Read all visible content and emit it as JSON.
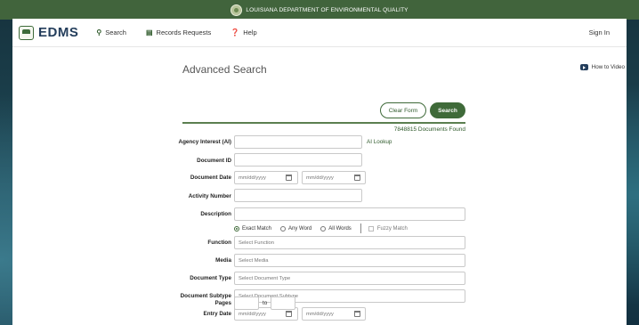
{
  "banner": {
    "text": "LOUISIANA DEPARTMENT OF ENVIRONMENTAL QUALITY"
  },
  "nav": {
    "logo": "EDMS",
    "items": [
      {
        "label": "Search",
        "icon": "search-icon"
      },
      {
        "label": "Records Requests",
        "icon": "document-icon"
      },
      {
        "label": "Help",
        "icon": "help-icon"
      }
    ],
    "signin": "Sign In"
  },
  "page": {
    "title": "Advanced Search",
    "howto": "How to Video",
    "clear_label": "Clear Form",
    "search_label": "Search",
    "found": "7848815 Documents Found"
  },
  "form": {
    "agency_interest": {
      "label": "Agency Interest (AI)",
      "value": "",
      "lookup": "AI Lookup"
    },
    "document_id": {
      "label": "Document ID",
      "value": ""
    },
    "document_date": {
      "label": "Document Date",
      "from_placeholder": "mm/dd/yyyy",
      "to_placeholder": "mm/dd/yyyy"
    },
    "activity_number": {
      "label": "Activity Number",
      "value": ""
    },
    "description": {
      "label": "Description",
      "value": "",
      "match_options": [
        "Exact Match",
        "Any Word",
        "All Words"
      ],
      "selected_match": "Exact Match",
      "fuzzy": "Fuzzy Match"
    },
    "function": {
      "label": "Function",
      "placeholder": "Select Function"
    },
    "media": {
      "label": "Media",
      "placeholder": "Select Media"
    },
    "document_type": {
      "label": "Document Type",
      "placeholder": "Select Document Type"
    },
    "document_subtype": {
      "label": "Document Subtype",
      "placeholder": "Select Document Subtype"
    },
    "entry_date": {
      "label": "Entry Date",
      "from_placeholder": "mm/dd/yyyy",
      "to_placeholder": "mm/dd/yyyy"
    },
    "pages": {
      "label": "Pages",
      "to": "to"
    }
  },
  "colors": {
    "brand_green": "#3f6a39",
    "banner_green": "#41643c",
    "logo_navy": "#243e5c"
  }
}
